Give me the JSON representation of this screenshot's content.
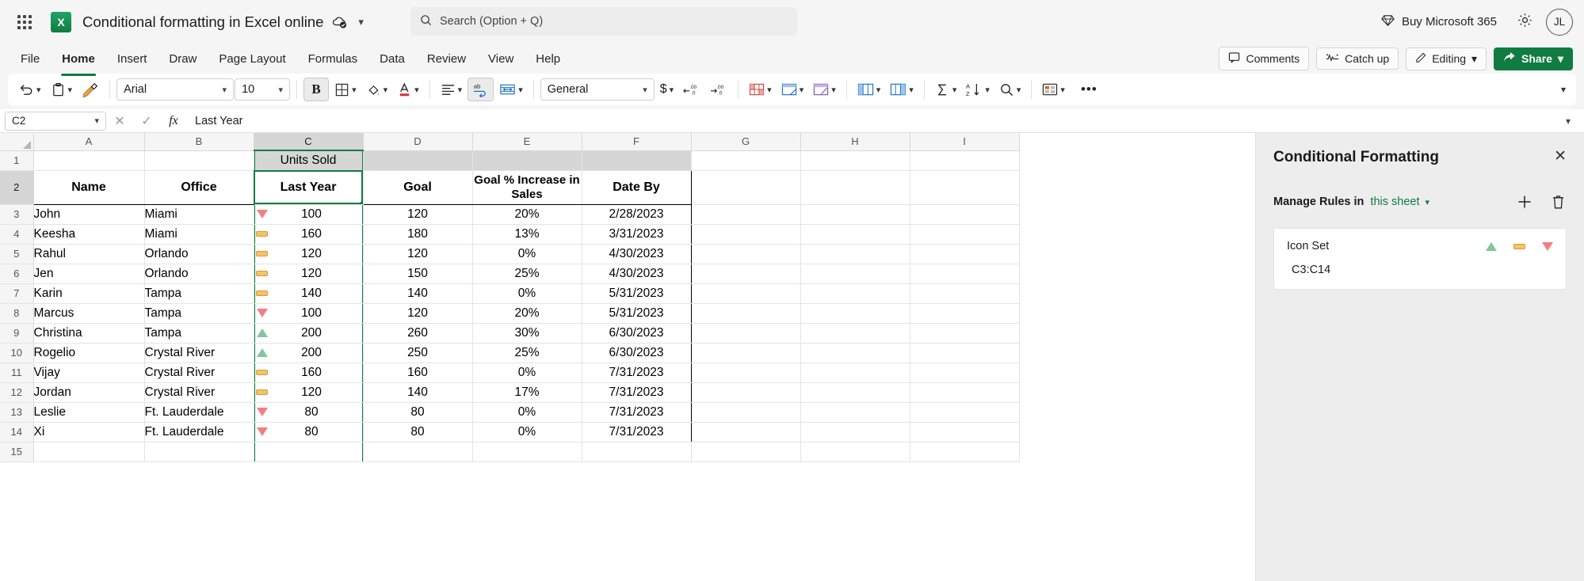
{
  "titlebar": {
    "app_launcher": "app-launcher",
    "doc_title": "Conditional formatting in Excel online",
    "search_placeholder": "Search (Option + Q)",
    "buy_label": "Buy Microsoft 365",
    "avatar_initials": "JL"
  },
  "tabs": [
    {
      "label": "File",
      "active": false
    },
    {
      "label": "Home",
      "active": true
    },
    {
      "label": "Insert",
      "active": false
    },
    {
      "label": "Draw",
      "active": false
    },
    {
      "label": "Page Layout",
      "active": false
    },
    {
      "label": "Formulas",
      "active": false
    },
    {
      "label": "Data",
      "active": false
    },
    {
      "label": "Review",
      "active": false
    },
    {
      "label": "View",
      "active": false
    },
    {
      "label": "Help",
      "active": false
    }
  ],
  "tabs_right": {
    "comments": "Comments",
    "catch_up": "Catch up",
    "editing": "Editing",
    "share": "Share"
  },
  "ribbon": {
    "font_name": "Arial",
    "font_size": "10",
    "bold_label": "B",
    "number_format": "General",
    "currency_symbol": "$",
    "more_label": "•••"
  },
  "formula_bar": {
    "name_box": "C2",
    "cancel": "✕",
    "enter": "✓",
    "fx": "fx",
    "formula": "Last Year"
  },
  "grid": {
    "columns": [
      "A",
      "B",
      "C",
      "D",
      "E",
      "F",
      "G",
      "H",
      "I"
    ],
    "selected_column": "C",
    "rows": [
      {
        "num": "1",
        "cells": [
          "",
          "",
          "Units Sold",
          "",
          "",
          "",
          "",
          "",
          ""
        ]
      },
      {
        "num": "2",
        "cells": [
          "Name",
          "Office",
          "Last Year",
          "Goal",
          "Goal % Increase in Sales",
          "Date By",
          "",
          "",
          ""
        ]
      },
      {
        "num": "3",
        "icon": "down",
        "cells": [
          "John",
          "Miami",
          "100",
          "120",
          "20%",
          "2/28/2023",
          "",
          "",
          ""
        ]
      },
      {
        "num": "4",
        "icon": "flat",
        "cells": [
          "Keesha",
          "Miami",
          "160",
          "180",
          "13%",
          "3/31/2023",
          "",
          "",
          ""
        ]
      },
      {
        "num": "5",
        "icon": "flat",
        "cells": [
          "Rahul",
          "Orlando",
          "120",
          "120",
          "0%",
          "4/30/2023",
          "",
          "",
          ""
        ]
      },
      {
        "num": "6",
        "icon": "flat",
        "cells": [
          "Jen",
          "Orlando",
          "120",
          "150",
          "25%",
          "4/30/2023",
          "",
          "",
          ""
        ]
      },
      {
        "num": "7",
        "icon": "flat",
        "cells": [
          "Karin",
          "Tampa",
          "140",
          "140",
          "0%",
          "5/31/2023",
          "",
          "",
          ""
        ]
      },
      {
        "num": "8",
        "icon": "down",
        "cells": [
          "Marcus",
          "Tampa",
          "100",
          "120",
          "20%",
          "5/31/2023",
          "",
          "",
          ""
        ]
      },
      {
        "num": "9",
        "icon": "up",
        "cells": [
          "Christina",
          "Tampa",
          "200",
          "260",
          "30%",
          "6/30/2023",
          "",
          "",
          ""
        ]
      },
      {
        "num": "10",
        "icon": "up",
        "cells": [
          "Rogelio",
          "Crystal River",
          "200",
          "250",
          "25%",
          "6/30/2023",
          "",
          "",
          ""
        ]
      },
      {
        "num": "11",
        "icon": "flat",
        "cells": [
          "Vijay",
          "Crystal River",
          "160",
          "160",
          "0%",
          "7/31/2023",
          "",
          "",
          ""
        ]
      },
      {
        "num": "12",
        "icon": "flat",
        "cells": [
          "Jordan",
          "Crystal River",
          "120",
          "140",
          "17%",
          "7/31/2023",
          "",
          "",
          ""
        ]
      },
      {
        "num": "13",
        "icon": "down",
        "cells": [
          "Leslie",
          "Ft. Lauderdale",
          "80",
          "80",
          "0%",
          "7/31/2023",
          "",
          "",
          ""
        ]
      },
      {
        "num": "14",
        "icon": "down",
        "cells": [
          "Xi",
          "Ft. Lauderdale",
          "80",
          "80",
          "0%",
          "7/31/2023",
          "",
          "",
          ""
        ]
      },
      {
        "num": "15",
        "cells": [
          "",
          "",
          "",
          "",
          "",
          "",
          "",
          "",
          ""
        ]
      }
    ]
  },
  "panel": {
    "title": "Conditional Formatting",
    "close": "✕",
    "manage_label": "Manage Rules in",
    "scope": "this sheet",
    "add_tooltip": "New Rule",
    "delete_tooltip": "Delete Rule",
    "rules": [
      {
        "name": "Icon Set",
        "range": "C3:C14",
        "icons": [
          "up",
          "flat",
          "down"
        ]
      }
    ]
  },
  "colors": {
    "excel_green": "#107c41",
    "icon_green": "#82c79a",
    "icon_amber": "#f5c26b",
    "icon_red": "#f0807f",
    "panel_bg": "#ededed"
  }
}
